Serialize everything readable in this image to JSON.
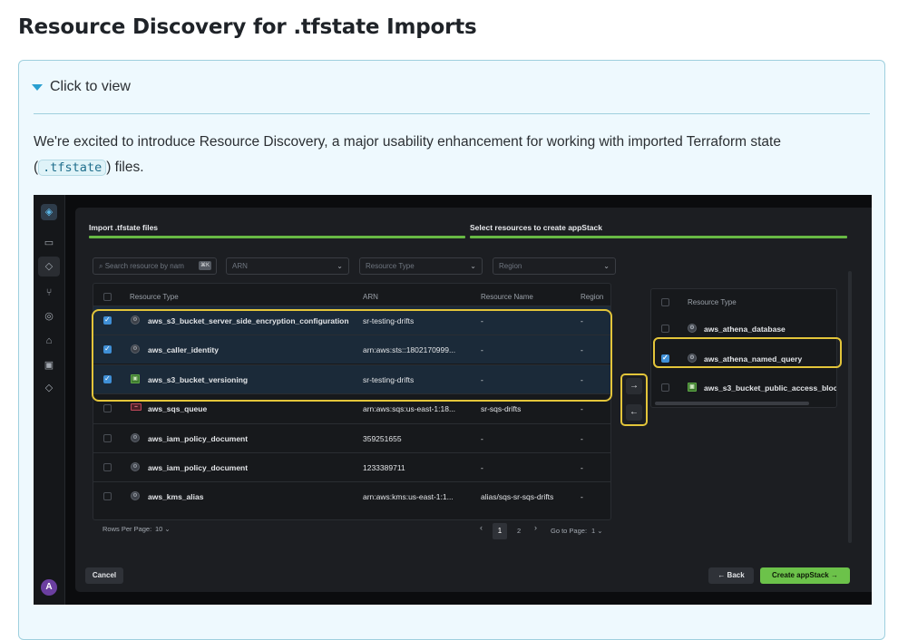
{
  "page": {
    "title": "Resource Discovery for .tfstate Imports",
    "summary_label": "Click to view",
    "intro_before": "We're excited to introduce Resource Discovery, a major usability enhancement for working with imported Terraform state (",
    "intro_code": ".tfstate",
    "intro_after": ") files."
  },
  "app": {
    "rail": {
      "icons": [
        "stack-logo-icon",
        "document-icon",
        "layers-icon",
        "branch-icon",
        "shield-icon",
        "bank-icon",
        "terminal-icon",
        "stack-icon"
      ],
      "avatar": "A"
    },
    "steps": [
      "Import .tfstate files",
      "Select resources to create appStack"
    ],
    "filters": {
      "search_placeholder": "Search resource by nam",
      "search_kbd": "⌘K",
      "arn": "ARN",
      "resource_type": "Resource Type",
      "region": "Region"
    },
    "table": {
      "columns": [
        "Resource Type",
        "ARN",
        "Resource Name",
        "Region"
      ],
      "rows": [
        {
          "type": "aws_s3_bucket_server_side_encryption_configuration",
          "arn": "sr-testing-drifts",
          "name": "-",
          "region": "-",
          "checked": true,
          "icon": "gear-icon"
        },
        {
          "type": "aws_caller_identity",
          "arn": "arn:aws:sts::1802170999...",
          "name": "-",
          "region": "-",
          "checked": true,
          "icon": "gear-icon"
        },
        {
          "type": "aws_s3_bucket_versioning",
          "arn": "sr-testing-drifts",
          "name": "-",
          "region": "-",
          "checked": true,
          "icon": "s3-icon"
        },
        {
          "type": "aws_sqs_queue",
          "arn": "arn:aws:sqs:us-east-1:18...",
          "name": "sr-sqs-drifts",
          "region": "-",
          "checked": false,
          "icon": "sqs-icon"
        },
        {
          "type": "aws_iam_policy_document",
          "arn": "359251655",
          "name": "-",
          "region": "-",
          "checked": false,
          "icon": "gear-icon"
        },
        {
          "type": "aws_iam_policy_document",
          "arn": "1233389711",
          "name": "-",
          "region": "-",
          "checked": false,
          "icon": "gear-icon"
        },
        {
          "type": "aws_kms_alias",
          "arn": "arn:aws:kms:us-east-1:1...",
          "name": "alias/sqs-sr-sqs-drifts",
          "region": "-",
          "checked": false,
          "icon": "gear-icon"
        }
      ]
    },
    "pagination": {
      "rows_per_page_label": "Rows Per Page:",
      "rows_per_page": "10",
      "pages": [
        "1",
        "2"
      ],
      "current_page": "1",
      "goto_label": "Go to Page:",
      "goto_value": "1"
    },
    "transfer": {
      "move_right": "→",
      "move_left": "←"
    },
    "right_table": {
      "column": "Resource Type",
      "rows": [
        {
          "type": "aws_athena_database",
          "checked": false,
          "icon": "gear-icon"
        },
        {
          "type": "aws_athena_named_query",
          "checked": true,
          "icon": "gear-icon"
        },
        {
          "type": "aws_s3_bucket_public_access_bloc",
          "checked": false,
          "icon": "s3-icon"
        }
      ]
    },
    "buttons": {
      "cancel": "Cancel",
      "back": "← Back",
      "create": "Create appStack →"
    }
  }
}
